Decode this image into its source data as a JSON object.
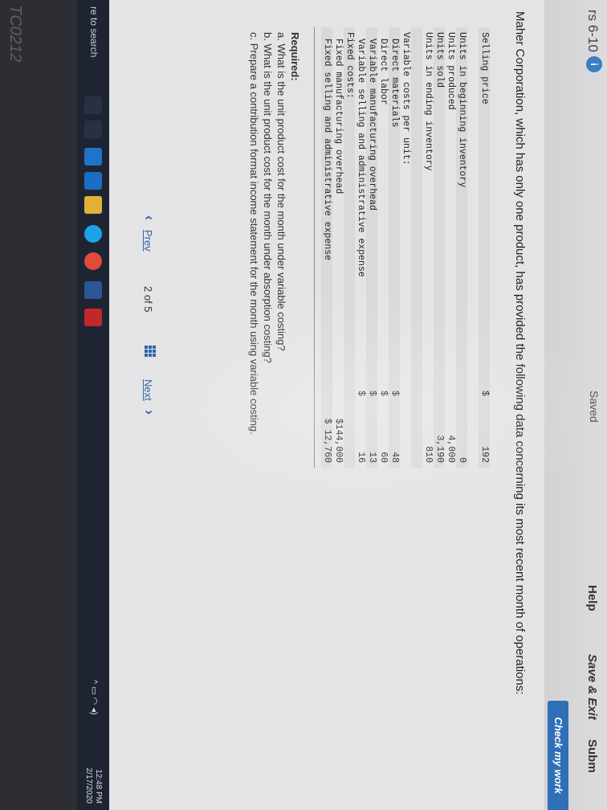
{
  "header": {
    "title": "rs 6-10",
    "badge": "i",
    "saved": "Saved",
    "help": "Help",
    "save_exit": "Save & Exit",
    "submit": "Subm",
    "check_my_work": "Check my work"
  },
  "question": "Maher Corporation, which has only one product, has provided the following data concerning its most recent month of operations:",
  "table": {
    "rows": [
      {
        "label": "Selling price",
        "currency": "$",
        "value": "192"
      },
      {
        "label": "",
        "currency": "",
        "value": ""
      },
      {
        "label": "Units in beginning inventory",
        "currency": "",
        "value": "0"
      },
      {
        "label": "Units produced",
        "currency": "",
        "value": "4,000"
      },
      {
        "label": "Units sold",
        "currency": "",
        "value": "3,190"
      },
      {
        "label": "Units in ending inventory",
        "currency": "",
        "value": "810"
      },
      {
        "label": "",
        "currency": "",
        "value": ""
      },
      {
        "label": "Variable costs per unit:",
        "currency": "",
        "value": ""
      },
      {
        "label": "Direct materials",
        "currency": "$",
        "value": "48"
      },
      {
        "label": "Direct labor",
        "currency": "$",
        "value": "60"
      },
      {
        "label": "Variable manufacturing overhead",
        "currency": "$",
        "value": "13"
      },
      {
        "label": "Variable selling and administrative expense",
        "currency": "$",
        "value": "16"
      },
      {
        "label": "Fixed costs:",
        "currency": "",
        "value": ""
      },
      {
        "label": "Fixed manufacturing overhead",
        "currency": "",
        "value": "$144,000"
      },
      {
        "label": "Fixed selling and administrative expense",
        "currency": "",
        "value": "$ 12,760"
      }
    ]
  },
  "required": {
    "heading": "Required:",
    "a": "a. What is the unit product cost for the month under variable costing?",
    "b": "b. What is the unit product cost for the month under absorption costing?",
    "c": "c. Prepare a contribution format income statement for the month using variable costing."
  },
  "nav": {
    "prev": "Prev",
    "pager": "2 of 5",
    "next": "Next"
  },
  "taskbar": {
    "search": "re to search",
    "time": "12:48 PM",
    "date": "2/17/2020"
  },
  "bezel": {
    "label": "TC0212"
  },
  "colors": {
    "accent": "#2f6fb7",
    "taskbar": "#1f2433"
  }
}
